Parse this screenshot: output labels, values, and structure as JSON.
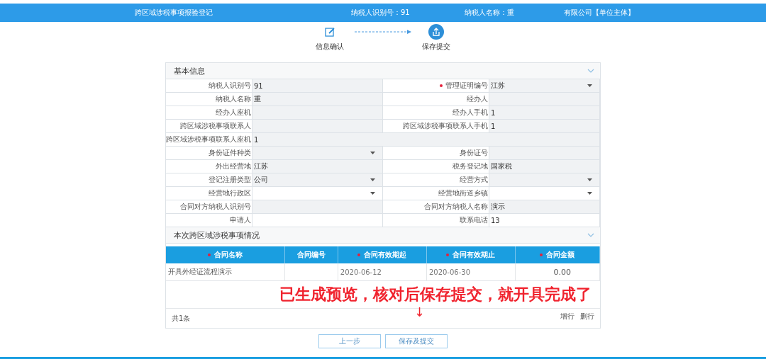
{
  "header": {
    "title": "跨区域涉税事项报验登记",
    "taxpayer_id": "纳税人识别号：91",
    "taxpayer_name": "纳税人名称：重",
    "entity": "有限公司【单位主体】"
  },
  "steps": [
    {
      "label": "信息确认",
      "selected": false
    },
    {
      "label": "保存提交",
      "selected": true
    }
  ],
  "basic_info": {
    "title": "基本信息",
    "expanded": true,
    "rows": [
      [
        {
          "label": "纳税人识别号",
          "value": "91",
          "kind": "text",
          "disabled": true,
          "required": false
        },
        {
          "label": "管理证明编号",
          "value": "江苏",
          "kind": "select",
          "disabled": true,
          "required": true
        }
      ],
      [
        {
          "label": "纳税人名称",
          "value": "重",
          "kind": "text",
          "disabled": true,
          "required": false
        },
        {
          "label": "经办人",
          "kind": "text",
          "disabled": true,
          "required": false
        }
      ],
      [
        {
          "label": "经办人座机",
          "kind": "text",
          "disabled": true,
          "required": false
        },
        {
          "label": "经办人手机",
          "value": "1",
          "kind": "text",
          "disabled": true,
          "required": false
        }
      ],
      [
        {
          "label": "跨区域涉税事项联系人",
          "kind": "text",
          "disabled": true,
          "required": false
        },
        {
          "label": "跨区域涉税事项联系人手机",
          "value": "1",
          "kind": "text",
          "disabled": true,
          "required": false
        }
      ],
      [
        {
          "label": "跨区域涉税事项联系人座机",
          "value": "1",
          "kind": "wide",
          "disabled": true,
          "required": false
        }
      ],
      [
        {
          "label": "身份证件种类",
          "kind": "select",
          "disabled": true,
          "required": false
        },
        {
          "label": "身份证号",
          "kind": "text",
          "disabled": true,
          "required": false
        }
      ],
      [
        {
          "label": "外出经营地",
          "value": "江苏",
          "kind": "text",
          "disabled": true,
          "required": false
        },
        {
          "label": "税务登记地",
          "value": "国家税",
          "kind": "text",
          "disabled": true,
          "required": false
        }
      ],
      [
        {
          "label": "登记注册类型",
          "value": "公司",
          "kind": "select",
          "disabled": true,
          "required": false
        },
        {
          "label": "经营方式",
          "kind": "select",
          "disabled": true,
          "required": false
        }
      ],
      [
        {
          "label": "经营地行政区",
          "kind": "select",
          "disabled": false,
          "required": false
        },
        {
          "label": "经营地街道乡镇",
          "kind": "select",
          "disabled": false,
          "required": false
        }
      ],
      [
        {
          "label": "合同对方纳税人识别号",
          "kind": "text",
          "disabled": true,
          "required": false
        },
        {
          "label": "合同对方纳税人名称",
          "value": "演示",
          "kind": "text",
          "disabled": true,
          "required": false
        }
      ],
      [
        {
          "label": "申请人",
          "kind": "text",
          "disabled": false,
          "required": false
        },
        {
          "label": "联系电话",
          "value": "13",
          "kind": "text",
          "disabled": false,
          "required": false
        }
      ]
    ]
  },
  "matters": {
    "title": "本次跨区域涉税事项情况",
    "expanded": true,
    "columns": [
      {
        "label": "合同名称",
        "required": true,
        "kind": "text"
      },
      {
        "label": "合同编号",
        "required": false,
        "kind": "text"
      },
      {
        "label": "合同有效期起",
        "required": true,
        "kind": "date"
      },
      {
        "label": "合同有效期止",
        "required": true,
        "kind": "date"
      },
      {
        "label": "合同金额",
        "required": true,
        "kind": "amount"
      }
    ],
    "rows": [
      [
        "开具外经证流程演示",
        null,
        "2020-06-12",
        "2020-06-30",
        "0.00"
      ]
    ],
    "annotation": "已生成预览，核对后保存提交，就开具完成了",
    "annotation_arrow": "↓",
    "total": "共1条",
    "actions": [
      "增行",
      "删行"
    ]
  },
  "buttons": [
    "上一步",
    "保存及提交"
  ]
}
